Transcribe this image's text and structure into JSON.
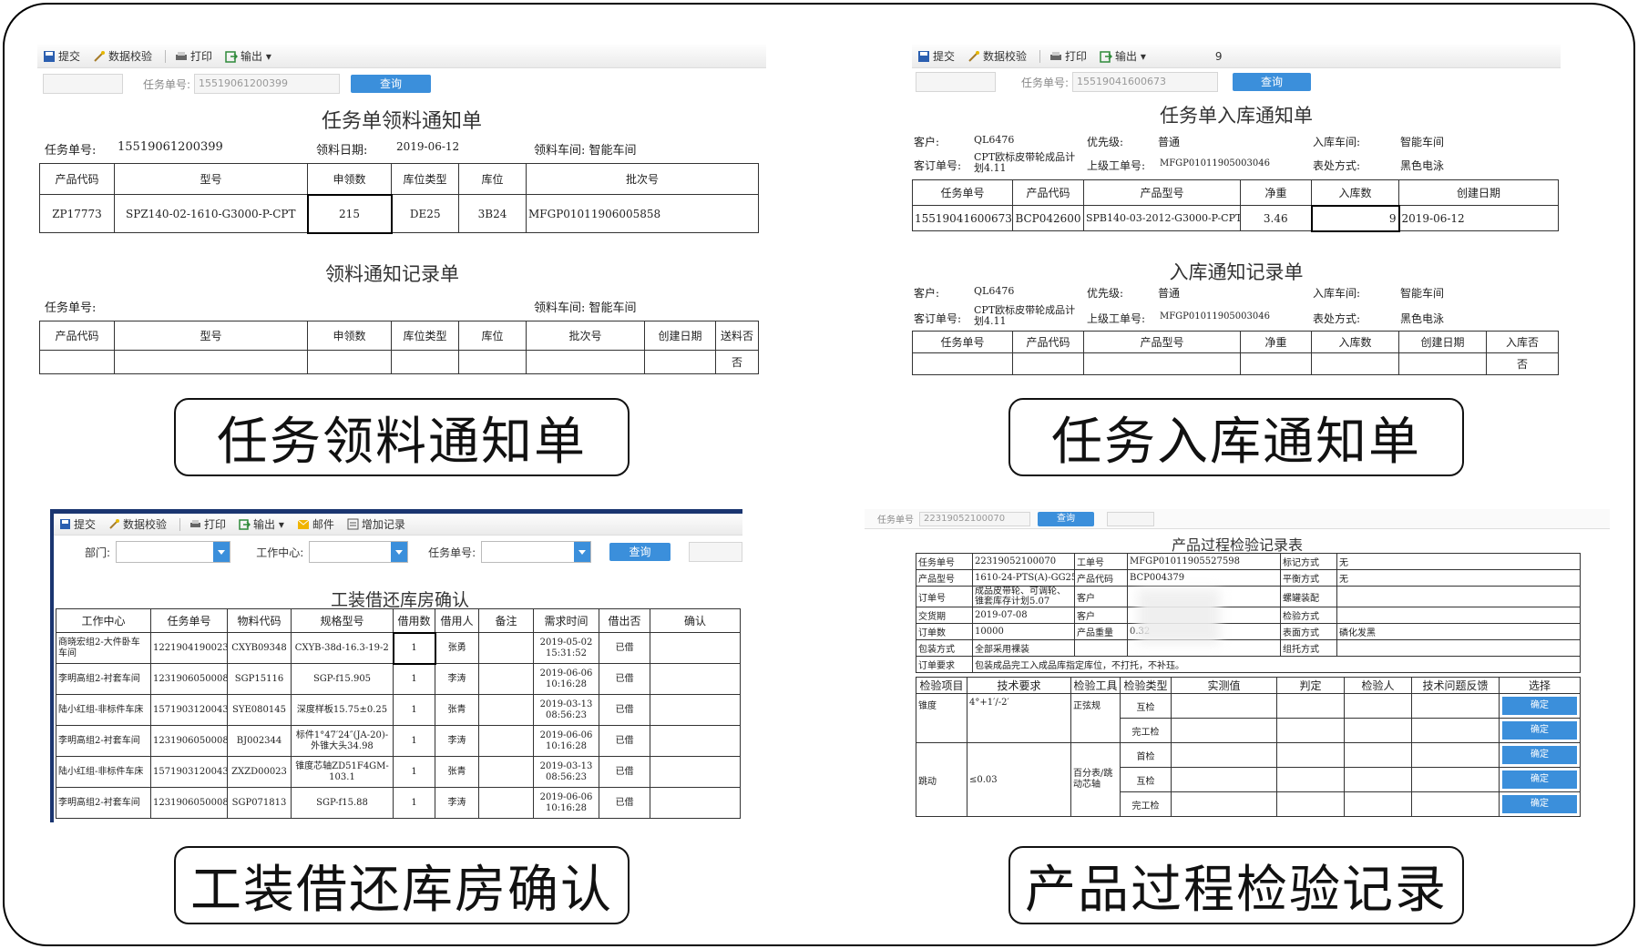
{
  "toolbar": {
    "submit": "提交",
    "validate": "数据校验",
    "print": "打印",
    "export": "输出",
    "mail": "邮件",
    "add_record": "增加记录"
  },
  "p1": {
    "search_label": "任务单号:",
    "search_value": "15519061200399",
    "query": "查询",
    "title": "任务单领料通知单",
    "info": {
      "task_label": "任务单号:",
      "task_value": "15519061200399",
      "date_label": "领料日期:",
      "date_value": "2019-06-12",
      "workshop": "领料车间: 智能车间"
    },
    "headers": [
      "产品代码",
      "型号",
      "申领数",
      "库位类型",
      "库位",
      "批次号"
    ],
    "row": [
      "ZP17773",
      "SPZ140-02-1610-G3000-P-CPT",
      "215",
      "DE25",
      "3B24",
      "MFGP01011906005858"
    ],
    "title2": "领料通知记录单",
    "info2": {
      "task_label": "任务单号:",
      "workshop": "领料车间: 智能车间"
    },
    "headers2": [
      "产品代码",
      "型号",
      "申领数",
      "库位类型",
      "库位",
      "批次号",
      "创建日期",
      "送料否"
    ],
    "row2_last": "否"
  },
  "p2": {
    "extra": "9",
    "search_label": "任务单号:",
    "search_value": "15519041600673",
    "query": "查询",
    "title": "任务单入库通知单",
    "info": {
      "cust_label": "客户:",
      "cust_value": "QL6476",
      "prio_label": "优先级:",
      "prio_value": "普通",
      "ws_label": "入库车间:",
      "ws_value": "智能车间",
      "order_label": "客订单号:",
      "order_value": "CPT欧标皮带轮成品计划4.11",
      "upper_label": "上级工单号:",
      "upper_value": "MFGP01011905003046",
      "treat_label": "表处方式:",
      "treat_value": "黑色电泳"
    },
    "headers": [
      "任务单号",
      "产品代码",
      "产品型号",
      "净重",
      "入库数",
      "创建日期"
    ],
    "row": [
      "15519041600673",
      "BCP042600",
      "SPB140-03-2012-G3000-P-CPT",
      "3.46",
      "9",
      "2019-06-12"
    ],
    "title2": "入库通知记录单",
    "headers2": [
      "任务单号",
      "产品代码",
      "产品型号",
      "净重",
      "入库数",
      "创建日期",
      "入库否"
    ],
    "row2_last": "否"
  },
  "p3": {
    "dept_label": "部门:",
    "center_label": "工作中心:",
    "task_label": "任务单号:",
    "query": "查询",
    "title": "工装借还库房确认",
    "headers": [
      "工作中心",
      "任务单号",
      "物料代码",
      "规格型号",
      "借用数",
      "借用人",
      "备注",
      "需求时间",
      "借出否",
      "确认"
    ],
    "rows": [
      [
        "商晓宏组2-大件卧车车间",
        "12219041900234",
        "CXYB09348",
        "CXYB-38d-16.3-19-2",
        "1",
        "张勇",
        "",
        "2019-05-02 15:31:52",
        "已借",
        ""
      ],
      [
        "李明高组2-衬套车间",
        "12319060500083",
        "SGP15116",
        "SGP-f15.905",
        "1",
        "李涛",
        "",
        "2019-06-06 10:16:28",
        "已借",
        ""
      ],
      [
        "陆小红组-非标件车床",
        "15719031200431",
        "SYE080145",
        "深度样板15.75±0.25",
        "1",
        "张青",
        "",
        "2019-03-13 08:56:23",
        "已借",
        ""
      ],
      [
        "李明高组2-衬套车间",
        "12319060500083",
        "BJ002344",
        "标件1°47′24″(JA-20)-外锥大头34.98",
        "1",
        "李涛",
        "",
        "2019-06-06 10:16:28",
        "已借",
        ""
      ],
      [
        "陆小红组-非标件车床",
        "15719031200431",
        "ZXZD00023",
        "锥度芯轴ZD51F4GM-103.1",
        "1",
        "张青",
        "",
        "2019-03-13 08:56:23",
        "已借",
        ""
      ],
      [
        "李明高组2-衬套车间",
        "12319060500083",
        "SGP071813",
        "SGP-f15.88",
        "1",
        "李涛",
        "",
        "2019-06-06 10:16:28",
        "已借",
        ""
      ]
    ]
  },
  "p4": {
    "search_label": "任务单号",
    "search_value": "22319052100070",
    "query": "查询",
    "title": "产品过程检验记录表",
    "rows_info": [
      [
        "任务单号",
        "22319052100070",
        "工单号",
        "MFGP01011905527598",
        "标记方式",
        "无"
      ],
      [
        "产品型号",
        "1610-24-PTS(A)-GG25",
        "产品代码",
        "BCP004379",
        "平衡方式",
        "无"
      ],
      [
        "订单号",
        "成品皮带轮、可调轮、锥套库存计划5.07",
        "客户",
        "",
        "螺罐装配",
        ""
      ],
      [
        "交货期",
        "2019-07-08",
        "客户",
        "",
        "检验方式",
        ""
      ],
      [
        "订单数",
        "10000",
        "产品重量",
        "0.32",
        "表面方式",
        "磷化发黑"
      ],
      [
        "包装方式",
        "全部采用裸装",
        "",
        "",
        "组托方式",
        ""
      ]
    ],
    "req_label": "订单要求",
    "req_value": "包装成品完工入成品库指定库位，不打托，不补珏。",
    "headers": [
      "检验项目",
      "技术要求",
      "检验工具",
      "检验类型",
      "实测值",
      "判定",
      "检验人",
      "技术问题反馈",
      "选择"
    ],
    "item1": "锥度",
    "req1": "4°+1′/-2′",
    "tool1": "正弦规",
    "item2": "跳动",
    "req2": "≤0.03",
    "tool2": "百分表/跳动芯轴",
    "types": [
      "互检",
      "完工检",
      "首检",
      "互检",
      "完工检"
    ],
    "ok": "确定"
  },
  "labels": [
    "任务领料通知单",
    "任务入库通知单",
    "工装借还库房确认",
    "产品过程检验记录"
  ]
}
